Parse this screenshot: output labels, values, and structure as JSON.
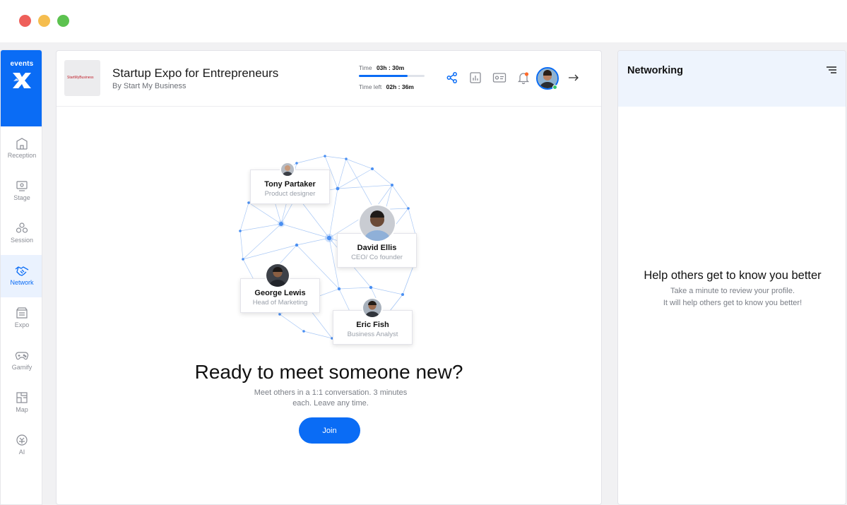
{
  "window": {
    "controls": [
      "close",
      "minimize",
      "maximize"
    ]
  },
  "brand": {
    "name": "events",
    "icon": "x-logo-icon",
    "color": "#0a6cf5"
  },
  "nav": {
    "items": [
      {
        "label": "Reception",
        "icon": "building-icon",
        "active": false
      },
      {
        "label": "Stage",
        "icon": "stage-icon",
        "active": false
      },
      {
        "label": "Session",
        "icon": "session-icon",
        "active": false
      },
      {
        "label": "Network",
        "icon": "handshake-icon",
        "active": true
      },
      {
        "label": "Expo",
        "icon": "booth-icon",
        "active": false
      },
      {
        "label": "Gamify",
        "icon": "gamepad-icon",
        "active": false
      },
      {
        "label": "Map",
        "icon": "map-icon",
        "active": false
      },
      {
        "label": "AI",
        "icon": "ai-icon",
        "active": false
      }
    ]
  },
  "header": {
    "logo_text": "StartMyBusiness",
    "title": "Startup Expo for Entrepreneurs",
    "subtitle": "By Start My Business",
    "time_label": "Time",
    "time_value": "03h : 30m",
    "time_left_label": "Time left",
    "time_left_value": "02h : 36m",
    "elapsed_fraction": 0.74,
    "icons": [
      "share-icon",
      "leaderboard-icon",
      "badge-card-icon",
      "bell-icon",
      "user-avatar",
      "exit-arrow-icon"
    ]
  },
  "people": [
    {
      "name": "Tony Partaker",
      "role": "Product designer"
    },
    {
      "name": "David Ellis",
      "role": "CEO/ Co founder"
    },
    {
      "name": "George Lewis",
      "role": "Head of Marketing"
    },
    {
      "name": "Eric Fish",
      "role": "Business Analyst"
    }
  ],
  "main": {
    "headline": "Ready to meet someone new?",
    "subline": "Meet others in a 1:1 conversation. 3 minutes each. Leave any time.",
    "join_label": "Join"
  },
  "networking": {
    "title": "Networking",
    "help_title": "Help others get to know you better",
    "help_line1": "Take a minute to review your profile.",
    "help_line2": "It will help others get to know you better!"
  }
}
